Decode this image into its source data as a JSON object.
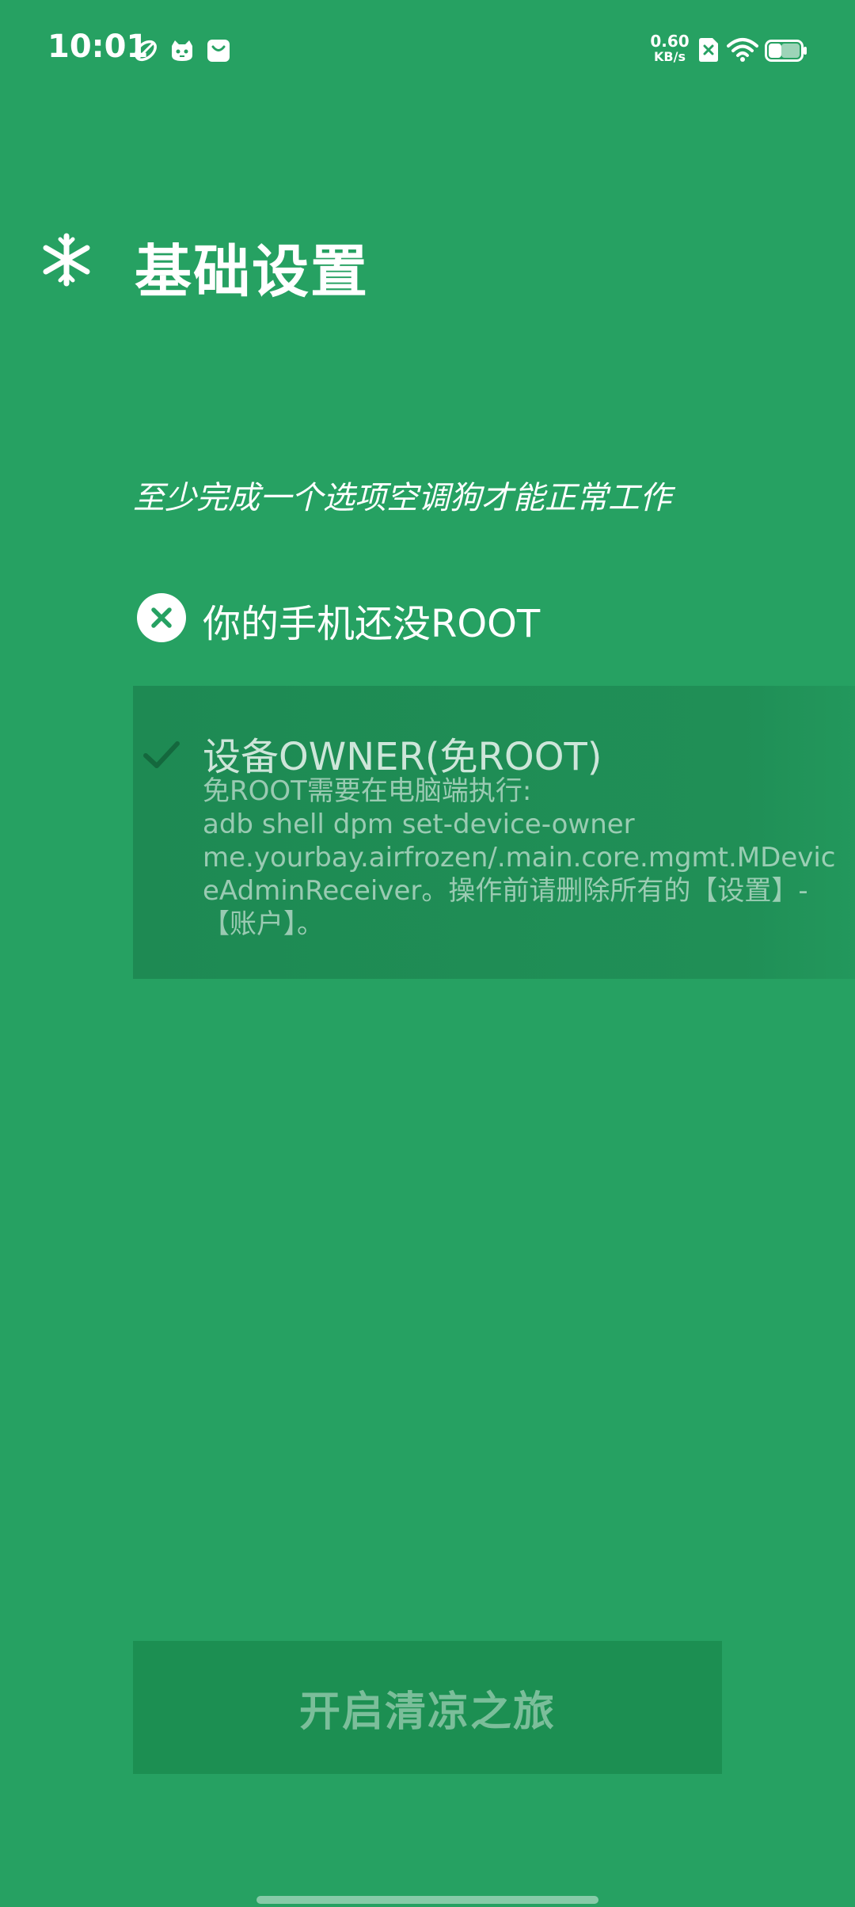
{
  "status_bar": {
    "time": "10:01",
    "net_speed_value": "0.60",
    "net_speed_unit": "KB/s",
    "icons": [
      "leaf-icon",
      "cat-face-icon",
      "bag-icon",
      "sim-x-icon",
      "wifi-icon",
      "battery-icon"
    ]
  },
  "header": {
    "icon": "snowflake-icon",
    "title": "基础设置"
  },
  "hint": "至少完成一个选项空调狗才能正常工作",
  "options": {
    "root": {
      "icon": "close-circle-icon",
      "label": "你的手机还没ROOT"
    },
    "owner": {
      "icon": "check-icon",
      "title": "设备OWNER(免ROOT)",
      "description": "免ROOT需要在电脑端执行:\nadb shell dpm set-device-owner\nme.yourbay.airfrozen/.main.core.mgmt.MDeviceAdminReceiver。操作前请删除所有的【设置】-【账户】。"
    }
  },
  "start_button": {
    "label": "开启清凉之旅"
  },
  "colors": {
    "background": "#26a162",
    "text": "#ffffff"
  }
}
